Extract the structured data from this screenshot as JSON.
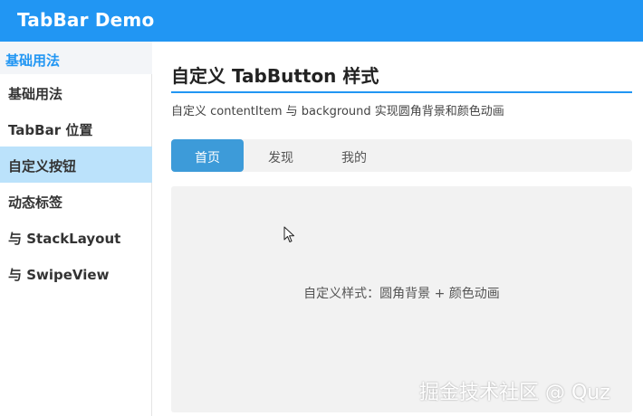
{
  "window": {
    "title": "TabBar Demo"
  },
  "sidebar": {
    "section_title": "基础用法",
    "items": [
      {
        "label": "基础用法"
      },
      {
        "label": "TabBar 位置"
      },
      {
        "label": "自定义按钮"
      },
      {
        "label": "动态标签"
      },
      {
        "label": "与 StackLayout"
      },
      {
        "label": "与 SwipeView"
      }
    ],
    "active_index": 2
  },
  "main": {
    "title": "自定义 TabButton 样式",
    "description": "自定义 contentItem 与 background 实现圆角背景和颜色动画",
    "tabs": [
      {
        "label": "首页"
      },
      {
        "label": "发现"
      },
      {
        "label": "我的"
      }
    ],
    "active_tab": 0,
    "panel_text": "自定义样式：圆角背景 + 颜色动画"
  },
  "watermark": "掘金技术社区 @ Quz",
  "colors": {
    "accent": "#2196f3",
    "active_nav_bg": "#bbe2fb",
    "active_tab_bg": "#3d9bd9",
    "panel_bg": "#f2f2f2"
  },
  "icons": {
    "cursor": "mouse-pointer-icon"
  }
}
